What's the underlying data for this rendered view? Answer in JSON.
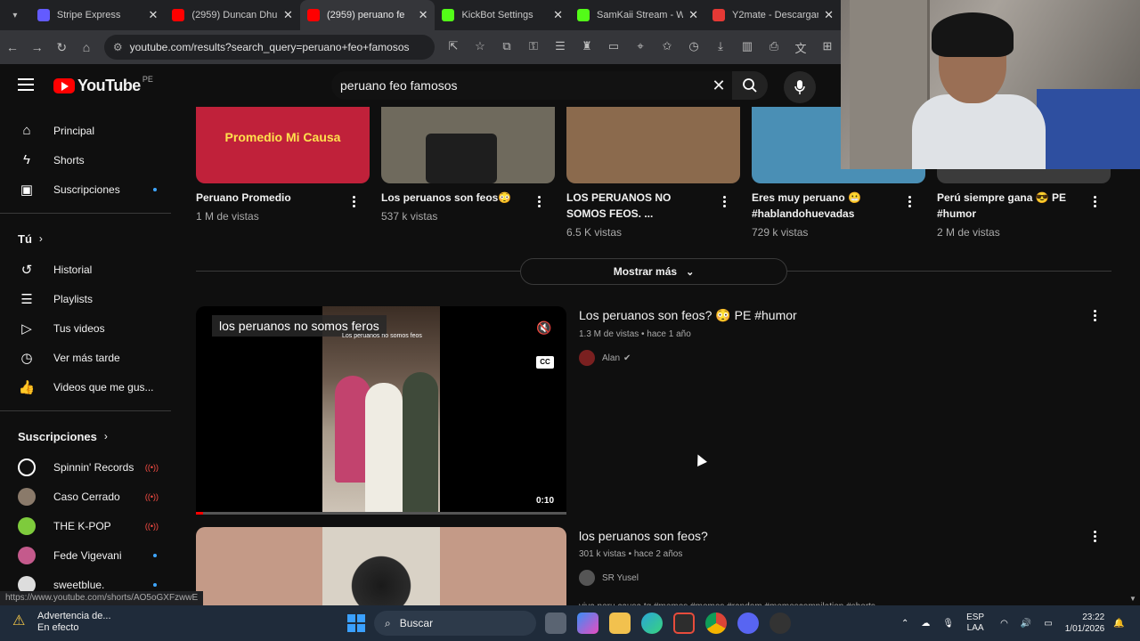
{
  "browser": {
    "tabs": [
      {
        "title": "Stripe Express",
        "color": "#635bff",
        "active": false
      },
      {
        "title": "(2959) Duncan Dhu",
        "color": "#ff0000",
        "active": false
      },
      {
        "title": "(2959) peruano fe",
        "color": "#ff0000",
        "active": true
      },
      {
        "title": "KickBot Settings",
        "color": "#53fc18",
        "active": false
      },
      {
        "title": "SamKaii Stream - Wa",
        "color": "#53fc18",
        "active": false
      },
      {
        "title": "Y2mate - Descargar",
        "color": "#e53935",
        "active": false
      }
    ],
    "url": "youtube.com/results?search_query=peruano+feo+famosos"
  },
  "header": {
    "logo_text": "YouTube",
    "region": "PE",
    "search_query": "peruano feo famosos"
  },
  "sidebar": {
    "main": [
      {
        "label": "Principal",
        "icon": "home-icon"
      },
      {
        "label": "Shorts",
        "icon": "shorts-icon"
      },
      {
        "label": "Suscripciones",
        "icon": "subscriptions-icon"
      }
    ],
    "you_heading": "Tú",
    "you": [
      {
        "label": "Historial",
        "icon": "history-icon"
      },
      {
        "label": "Playlists",
        "icon": "playlists-icon"
      },
      {
        "label": "Tus videos",
        "icon": "your-videos-icon"
      },
      {
        "label": "Ver más tarde",
        "icon": "watch-later-icon"
      },
      {
        "label": "Videos que me gus...",
        "icon": "liked-icon"
      }
    ],
    "subs_heading": "Suscripciones",
    "subs": [
      {
        "label": "Spinnin' Records",
        "status": "live"
      },
      {
        "label": "Caso Cerrado",
        "status": "live"
      },
      {
        "label": "THE K-POP",
        "status": "live"
      },
      {
        "label": "Fede Vigevani",
        "status": "dot"
      },
      {
        "label": "sweetblue.",
        "status": "dot"
      }
    ]
  },
  "shorts": [
    {
      "thumb_text": "Promedio Mi Causa",
      "title": "Peruano Promedio",
      "views": "1 M de vistas",
      "color": "#c0213a"
    },
    {
      "thumb_text": "",
      "title": "Los peruanos son feos😳",
      "views": "537 k vistas",
      "color": "#6f6a5d"
    },
    {
      "thumb_text": "",
      "title": "LOS PERUANOS NO SOMOS FEOS. ...",
      "views": "6.5 K vistas",
      "color": "#8b6a4d"
    },
    {
      "thumb_text": "",
      "title": "Eres muy peruano 😬 #hablandohuevadas",
      "views": "729 k vistas",
      "color": "#4a8fb5"
    },
    {
      "thumb_text": "",
      "title": "Perú siempre gana 😎 PE #humor",
      "views": "2 M de vistas",
      "color": "#3b3b3b"
    }
  ],
  "more_button": "Mostrar más",
  "videos": [
    {
      "title": "Los peruanos son feos? 😳 PE #humor",
      "meta": "1.3 M de vistas • hace 1 año",
      "channel": "Alan",
      "overlay_title": "los peruanos no somos feros",
      "overlay_sub": "Los peruanos no somos feos",
      "duration": "0:10",
      "progress": 0.02
    },
    {
      "title": "los peruanos son feos?",
      "meta": "301 k vistas • hace 2 años",
      "channel": "SR Yusel",
      "desc": "viva peru causa tq #memes #momos #random #memescompilation #shorts"
    }
  ],
  "status_url": "https://www.youtube.com/shorts/AO5oGXFzwwE",
  "taskbar": {
    "weather_title": "Advertencia de...",
    "weather_sub": "En efecto",
    "search": "Buscar",
    "lang1": "ESP",
    "lang2": "LAA",
    "time": "23:22",
    "date": "1/01/2026"
  }
}
